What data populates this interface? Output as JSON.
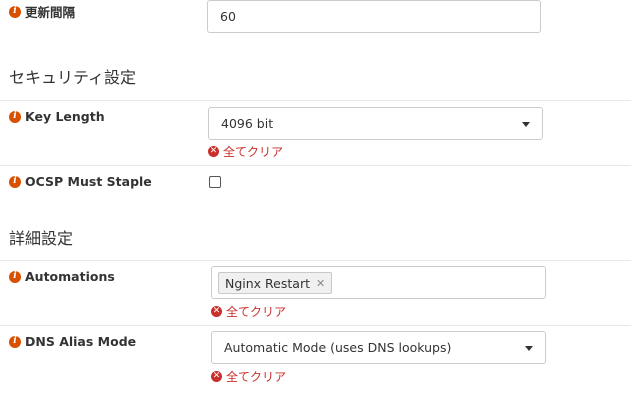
{
  "update_interval": {
    "label": "更新間隔",
    "value": "60"
  },
  "security_section": {
    "title": "セキュリティ設定"
  },
  "key_length": {
    "label": "Key Length",
    "selected": "4096 bit",
    "clear_label": "全てクリア"
  },
  "ocsp": {
    "label": "OCSP Must Staple",
    "checked": false
  },
  "advanced_section": {
    "title": "詳細設定"
  },
  "automations": {
    "label": "Automations",
    "tags": [
      "Nginx Restart"
    ],
    "clear_label": "全てクリア"
  },
  "dns_alias": {
    "label": "DNS Alias Mode",
    "selected": "Automatic Mode (uses DNS lookups)",
    "clear_label": "全てクリア"
  },
  "icons": {
    "info": "info-icon",
    "clear": "times-circle-icon",
    "caret": "caret-down-icon",
    "tag_remove": "close-icon"
  },
  "colors": {
    "info_icon": "#d94f00",
    "clear_text": "#c9302c"
  }
}
